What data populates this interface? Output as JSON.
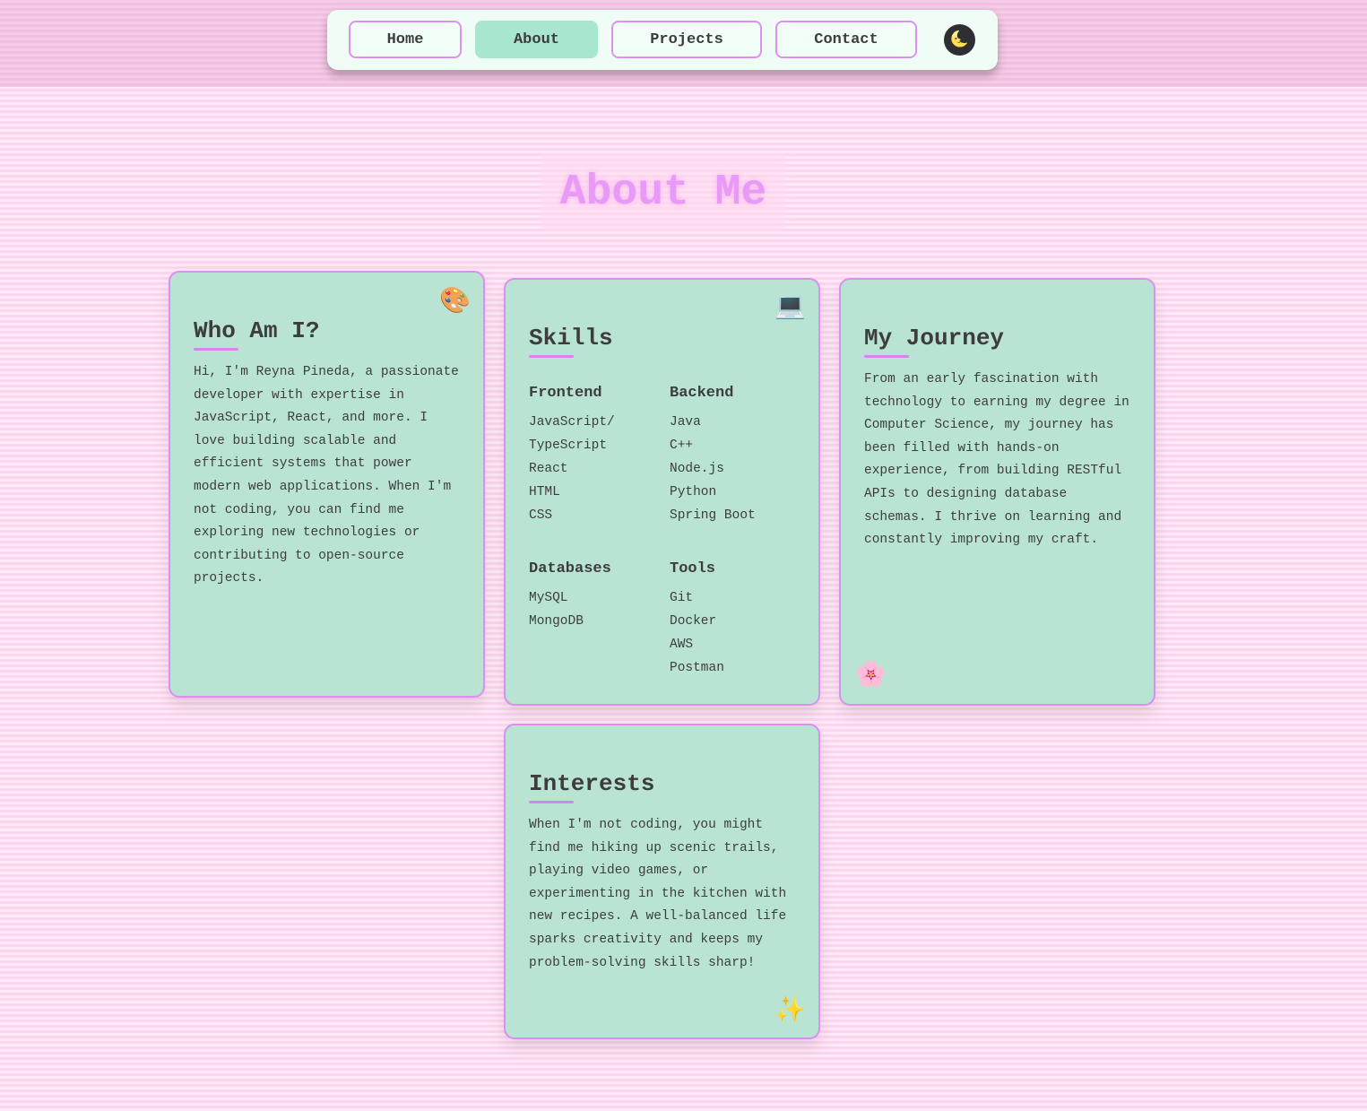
{
  "nav": {
    "items": [
      {
        "label": "Home",
        "active": false
      },
      {
        "label": "About",
        "active": true
      },
      {
        "label": "Projects",
        "active": false
      },
      {
        "label": "Contact",
        "active": false
      }
    ],
    "theme_toggle_icon": "🌜"
  },
  "page": {
    "title": "About Me"
  },
  "cards": {
    "who": {
      "title": "Who Am I?",
      "icon": "🎨",
      "icon_name": "palette-icon",
      "text": "Hi, I'm Reyna Pineda, a passionate developer with expertise in JavaScript, React, and more. I love building scalable and efficient systems that power modern web applications. When I'm not coding, you can find me exploring new technologies or contributing to open-source projects."
    },
    "skills": {
      "title": "Skills",
      "icon": "💻",
      "icon_name": "laptop-icon",
      "groups": [
        {
          "name": "Frontend",
          "items": [
            "JavaScript/",
            "TypeScript",
            "React",
            "HTML",
            "CSS"
          ]
        },
        {
          "name": "Backend",
          "items": [
            "Java",
            "C++",
            "Node.js",
            "Python",
            "Spring Boot"
          ]
        },
        {
          "name": "Databases",
          "items": [
            "MySQL",
            "MongoDB"
          ]
        },
        {
          "name": "Tools",
          "items": [
            "Git",
            "Docker",
            "AWS",
            "Postman"
          ]
        }
      ]
    },
    "journey": {
      "title": "My Journey",
      "icon": "🌸",
      "icon_name": "cherry-blossom-icon",
      "text": "From an early fascination with technology to earning my degree in Computer Science, my journey has been filled with hands-on experience, from building RESTful APIs to designing database schemas. I thrive on learning and constantly improving my craft."
    },
    "interests": {
      "title": "Interests",
      "icon": "✨",
      "icon_name": "sparkles-icon",
      "text": "When I'm not coding, you might find me hiking up scenic trails, playing video games, or experimenting in the kitchen with new recipes. A well-balanced life sparks creativity and keeps my problem-solving skills sharp!"
    }
  },
  "colors": {
    "accent": "#dc8ef2",
    "card_bg": "#b9e4d4",
    "active_nav": "#a8e6cf",
    "title": "#e89af8"
  }
}
